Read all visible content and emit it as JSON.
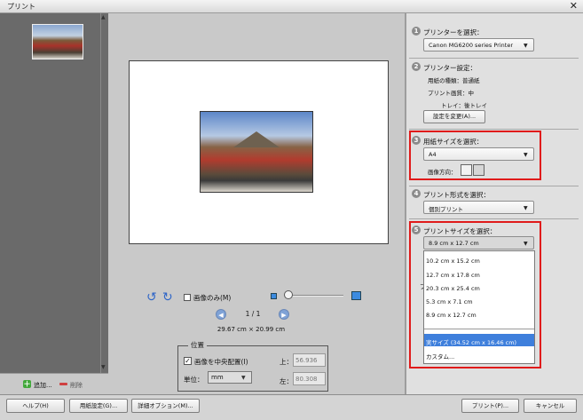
{
  "window": {
    "title": "プリント",
    "close_glyph": "✕"
  },
  "thumbnails": {
    "scroll_up_glyph": "▲",
    "scroll_down_glyph": "▼"
  },
  "thumb_actions": {
    "add_icon": "＋",
    "add_label": "追加...",
    "remove_label": "削除"
  },
  "preview": {
    "image_only_label": "画像のみ(M)",
    "rotate_left_icon": "↺",
    "rotate_right_icon": "↻",
    "prev_icon": "◀",
    "next_icon": "▶",
    "page_indicator": "1 / 1",
    "paper_dimensions": "29.67 cm × 20.99 cm"
  },
  "position": {
    "title": "位置",
    "center_label": "画像を中央配置(I)",
    "center_checked": true,
    "check_glyph": "✓",
    "unit_label": "単位：",
    "unit_value": "mm",
    "dropdown_arrow": "▼",
    "top_label": "上：",
    "top_value": "56.936",
    "left_label": "左：",
    "left_value": "80.308"
  },
  "settings": {
    "printer": {
      "step": "1",
      "label": "プリンターを選択：",
      "value": "Canon MG6200 series Printer"
    },
    "printer_settings": {
      "step": "2",
      "label": "プリンター設定：",
      "paper_type": "用紙の種類：普通紙",
      "print_quality": "プリント画質：中",
      "tray": "トレイ：後トレイ",
      "change_button": "設定を変更(A)..."
    },
    "paper_size": {
      "step": "3",
      "label": "用紙サイズを選択：",
      "value": "A4",
      "orientation_label": "画像方向："
    },
    "print_type": {
      "step": "4",
      "label": "プリント形式を選択：",
      "value": "個別プリント"
    },
    "print_size": {
      "step": "5",
      "label": "プリントサイズを選択：",
      "value": "8.9 cm x 12.7 cm",
      "options": [
        "10.2 cm x 15.2 cm",
        "12.7 cm x 17.8 cm",
        "20.3 cm x 25.4 cm",
        "5.3 cm x 7.1 cm",
        "8.9 cm x 12.7 cm",
        "実サイズ (34.52 cm x 16.46 cm)",
        "カスタム..."
      ],
      "selected_option": "実サイズ (34.52 cm x 16.46 cm)",
      "partial_hidden_text": "プ"
    }
  },
  "colors": {
    "highlight_red": "#e01b1b",
    "selection_blue": "#3e7fdc"
  },
  "bottom_buttons": {
    "help": "ヘルプ(H)",
    "page_setup": "用紙設定(G)...",
    "more_options": "詳細オプション(M)...",
    "print": "プリント(P)...",
    "cancel": "キャンセル"
  }
}
